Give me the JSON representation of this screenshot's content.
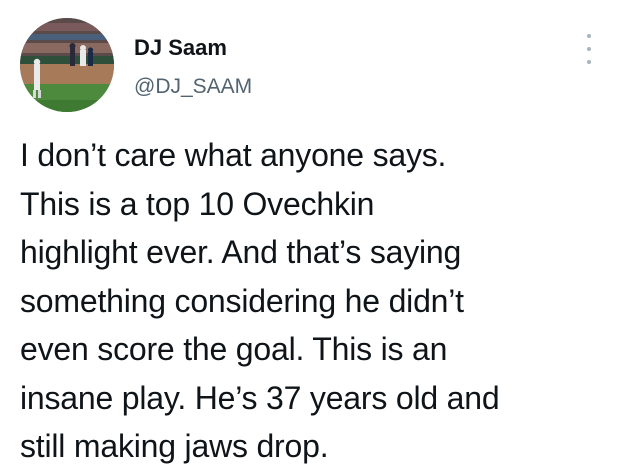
{
  "author": {
    "display_name": "DJ Saam",
    "handle": "@DJ_SAAM",
    "avatar_icon": "baseball-field-photo-avatar"
  },
  "menu": {
    "icon": "more-options-icon"
  },
  "tweet": {
    "text": "I don’t care what anyone says.\nThis is a top 10 Ovechkin\nhighlight ever. And that’s saying\nsomething considering he didn’t\neven score the goal. This is an\ninsane play. He’s 37 years old and\nstill making jaws drop."
  }
}
